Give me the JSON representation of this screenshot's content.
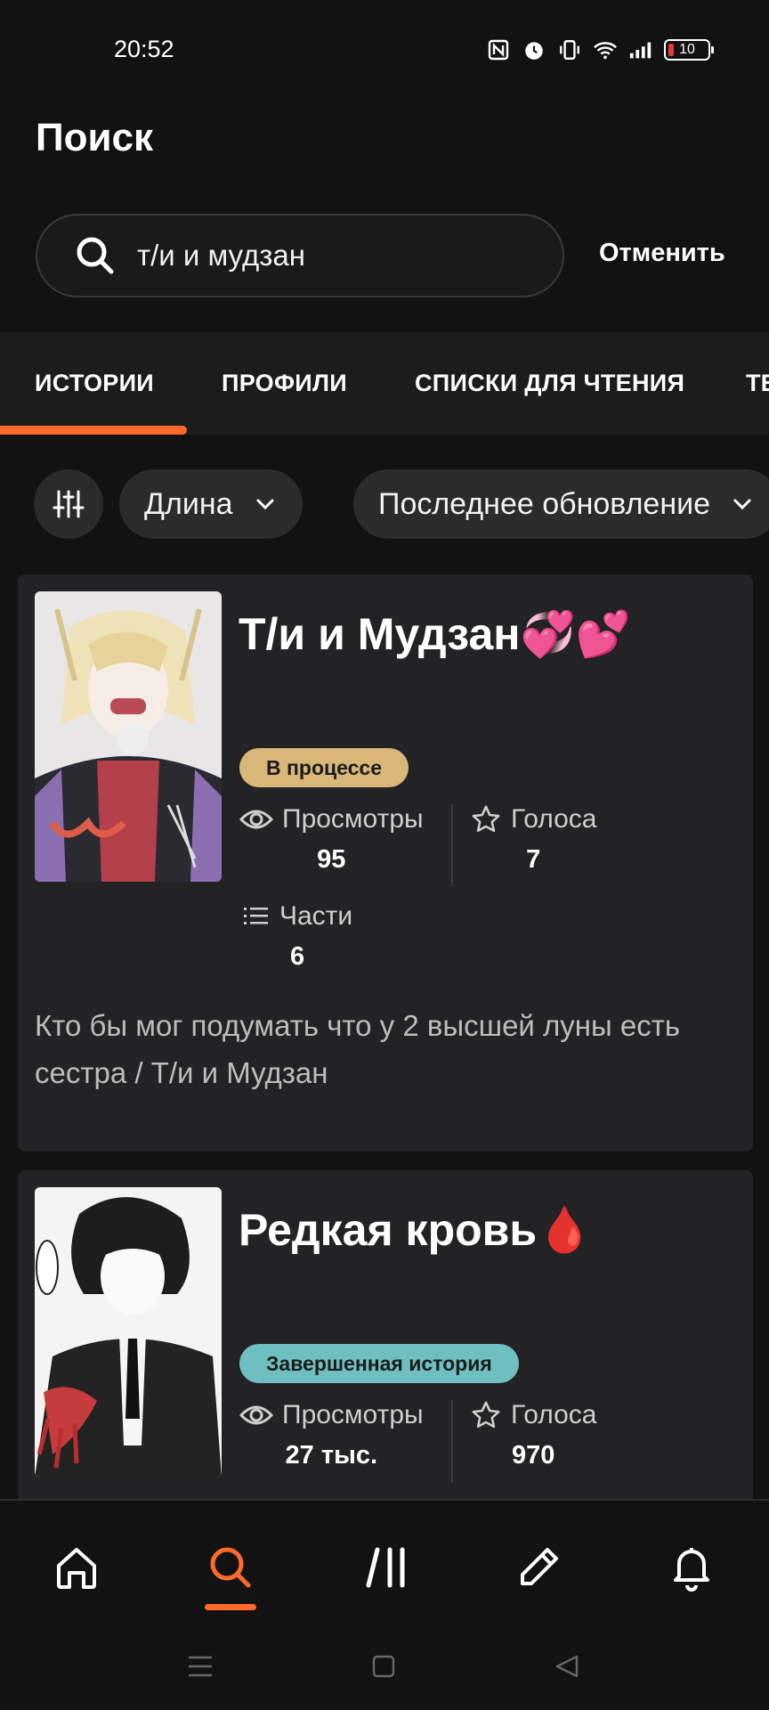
{
  "status": {
    "time": "20:52",
    "battery": "10"
  },
  "header": {
    "title": "Поиск"
  },
  "search": {
    "value": "т/и и мудзан",
    "cancel_label": "Отменить"
  },
  "tabs": [
    {
      "label": "ИСТОРИИ"
    },
    {
      "label": "ПРОФИЛИ"
    },
    {
      "label": "СПИСКИ ДЛЯ ЧТЕНИЯ"
    },
    {
      "label": "ТЕ"
    }
  ],
  "filters": {
    "length_label": "Длина",
    "sort_label": "Последнее обновление"
  },
  "colors": {
    "accent": "#ff6a2b",
    "badge_in_progress": "#d9b778",
    "badge_complete": "#6fbfc1",
    "card_bg": "#232225"
  },
  "stories": [
    {
      "title": "Т/и  и Мудзан💞💕",
      "status": "В процессе",
      "views_label": "Просмотры",
      "views": "95",
      "votes_label": "Голоса",
      "votes": "7",
      "parts_label": "Части",
      "parts": "6",
      "description": "Кто бы мог подумать что у 2 высшей луны есть сестра / Т/и и Мудзан"
    },
    {
      "title": "Редкая кровь🩸",
      "status": "Завершенная история",
      "views_label": "Просмотры",
      "views": "27 тыс.",
      "votes_label": "Голоса",
      "votes": "970"
    }
  ],
  "bottom_nav": {
    "items": [
      "home-icon",
      "search-icon",
      "library-icon",
      "write-icon",
      "bell-icon"
    ],
    "active": "search-icon"
  }
}
